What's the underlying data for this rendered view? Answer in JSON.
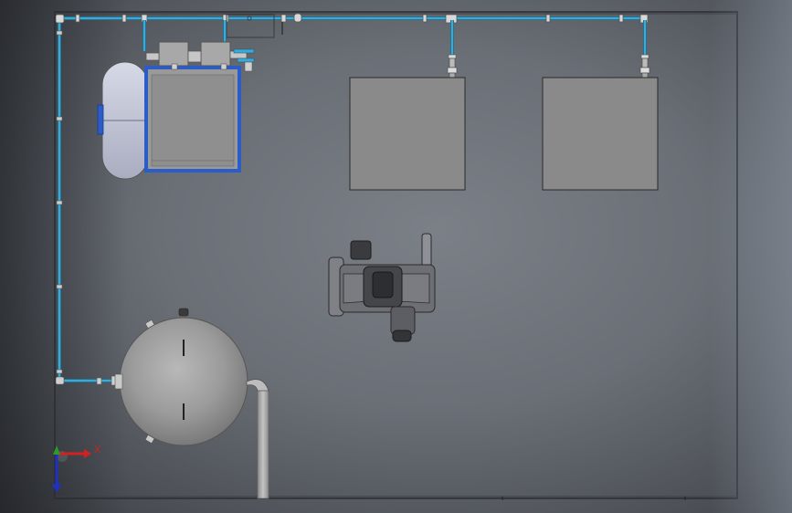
{
  "viewport": {
    "colors": {
      "floor_edge": "#2a2c30",
      "pipe": "#3fa9d6",
      "pipe_outline": "#1d5f7a",
      "frame_blue": "#2b5cc7",
      "panel_gray": "#8a8a8a",
      "tank_gray": "#9a9a9a",
      "machine_dark": "#4a4c50"
    }
  },
  "triad": {
    "x_label": "X",
    "x_color": "#d42020",
    "y_color": "#2a9a2a",
    "z_color": "#2030c0"
  },
  "icons": {
    "triad": "axis-triad-icon"
  }
}
